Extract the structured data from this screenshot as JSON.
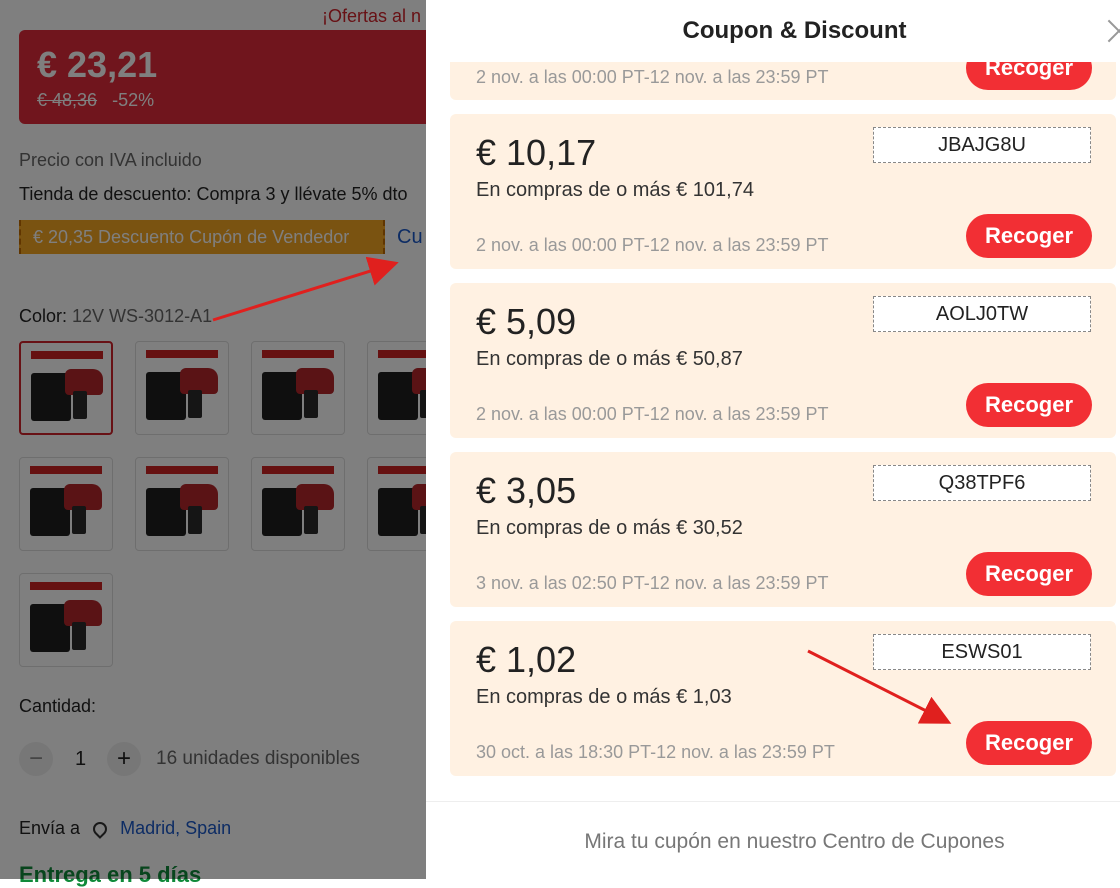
{
  "product": {
    "offer_banner": "¡Ofertas al n",
    "price": "€ 23,21",
    "old_price": "€ 48,36",
    "discount": "-52%",
    "vat_note": "Precio con IVA incluido",
    "store_discount": "Tienda de descuento: Compra 3 y llévate 5% dto",
    "seller_coupon": "€ 20,35 Descuento Cupón de Vendedor",
    "coupons_link": "Cu",
    "color_label": "Color:",
    "color_value": "12V WS-3012-A1",
    "quantity_label": "Cantidad:",
    "quantity_minus": "−",
    "quantity_plus": "+",
    "quantity": "1",
    "available": "16 unidades disponibles",
    "ship_label": "Envía a",
    "ship_location": "Madrid, Spain",
    "delivery": "Entrega en 5 días"
  },
  "drawer": {
    "title": "Coupon & Discount",
    "footer_link": "Mira tu cupón en nuestro Centro de Cupones",
    "coupons": [
      {
        "amount": "",
        "min": "",
        "code": "",
        "date": "2 nov. a las 00:00 PT-12 nov. a las 23:59 PT",
        "button": "Recoger"
      },
      {
        "amount": "€ 10,17",
        "min": "En compras de o más € 101,74",
        "code": "JBAJG8U",
        "date": "2 nov. a las 00:00 PT-12 nov. a las 23:59 PT",
        "button": "Recoger"
      },
      {
        "amount": "€ 5,09",
        "min": "En compras de o más € 50,87",
        "code": "AOLJ0TW",
        "date": "2 nov. a las 00:00 PT-12 nov. a las 23:59 PT",
        "button": "Recoger"
      },
      {
        "amount": "€ 3,05",
        "min": "En compras de o más € 30,52",
        "code": "Q38TPF6",
        "date": "3 nov. a las 02:50 PT-12 nov. a las 23:59 PT",
        "button": "Recoger"
      },
      {
        "amount": "€ 1,02",
        "min": "En compras de o más € 1,03",
        "code": "ESWS01",
        "date": "30 oct. a las 18:30 PT-12 nov. a las 23:59 PT",
        "button": "Recoger"
      }
    ]
  },
  "colors": {
    "accent": "#f22f34",
    "coupon_bg": "#fff1e2",
    "annotation_arrow": "#e0201e"
  }
}
